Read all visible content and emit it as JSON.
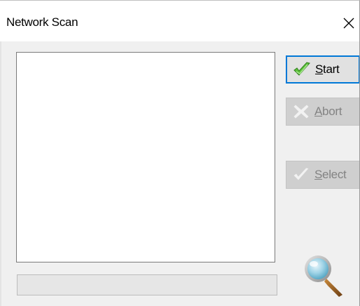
{
  "window": {
    "title": "Network Scan",
    "close_icon": "close-icon"
  },
  "list": {
    "items": []
  },
  "progress": {
    "value": 0
  },
  "buttons": {
    "start": {
      "hotkey": "S",
      "rest": "tart",
      "icon": "check-icon",
      "enabled": true,
      "focused": true
    },
    "abort": {
      "hotkey": "A",
      "rest": "bort",
      "icon": "x-icon",
      "enabled": false
    },
    "select": {
      "hotkey": "S",
      "rest": "elect",
      "icon": "check-icon",
      "enabled": false
    }
  },
  "decorations": {
    "search_icon": "magnifier-icon"
  },
  "colors": {
    "focus_border": "#0078d7",
    "start_check": "#5cc23a",
    "disabled_text": "#838383",
    "disabled_icon": "#f2f2f2"
  }
}
